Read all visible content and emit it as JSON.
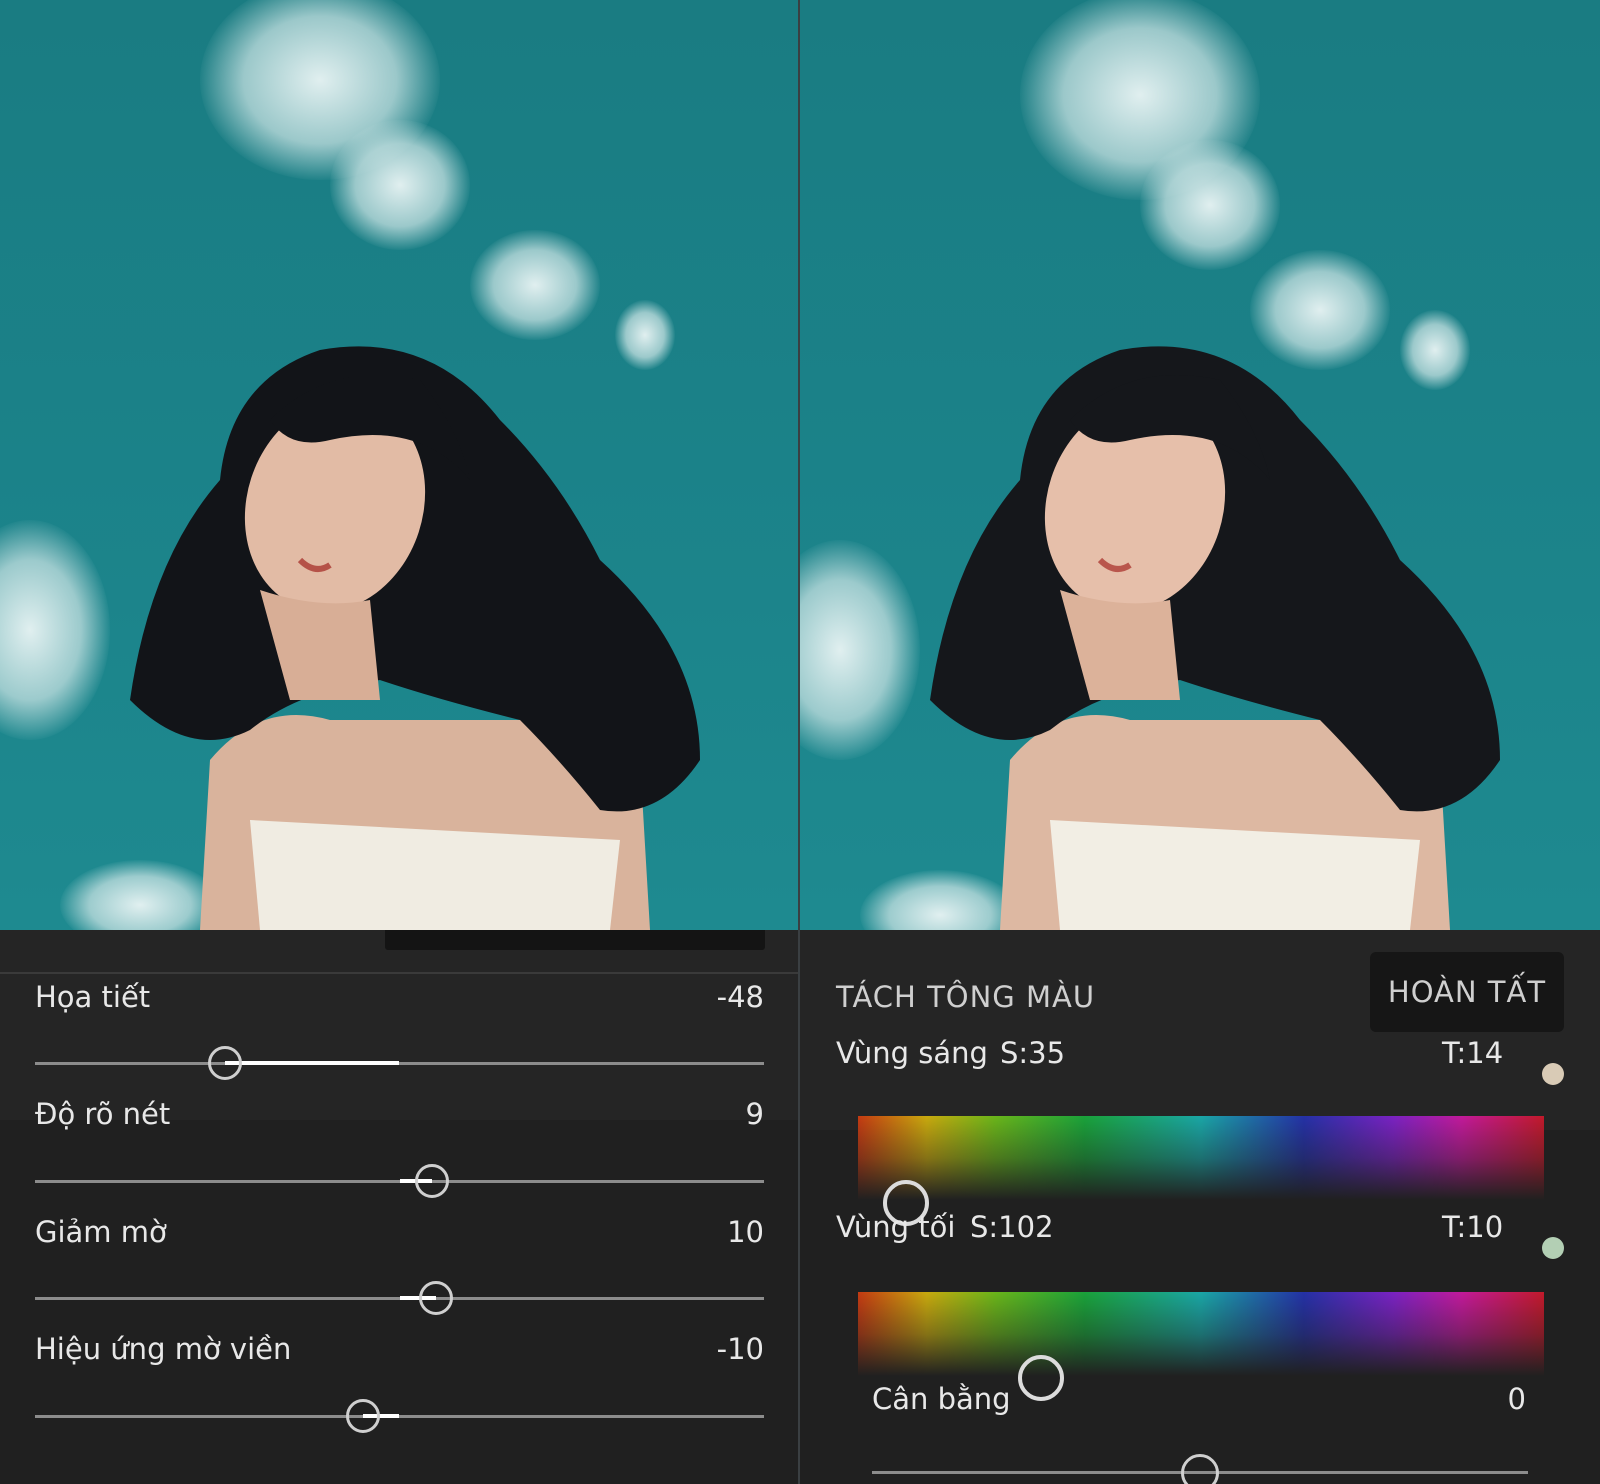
{
  "left_panel": {
    "sliders": [
      {
        "label": "Họa tiết",
        "value": "-48",
        "fraction": 0.26
      },
      {
        "label": "Độ rõ nét",
        "value": "9",
        "fraction": 0.545
      },
      {
        "label": "Giảm mờ",
        "value": "10",
        "fraction": 0.55
      },
      {
        "label": "Hiệu ứng mờ viền",
        "value": "-10",
        "fraction": 0.45
      }
    ]
  },
  "right_panel": {
    "title": "TÁCH TÔNG MÀU",
    "done_label": "HOÀN TẤT",
    "highlights": {
      "label": "Vùng sáng",
      "saturation": "S:35",
      "tone": "T:14",
      "swatch_color": "#d9cbb6"
    },
    "shadows": {
      "label": "Vùng tối",
      "saturation": "S:102",
      "tone": "T:10",
      "swatch_color": "#b3cfb4"
    },
    "balance": {
      "label": "Cân bằng",
      "value": "0",
      "fraction": 0.5
    }
  }
}
